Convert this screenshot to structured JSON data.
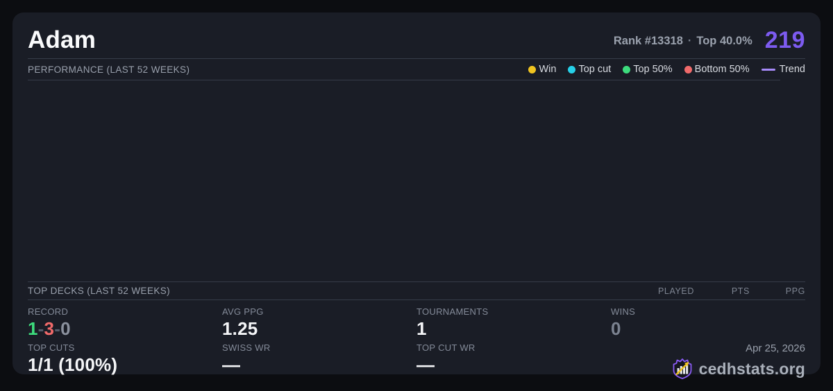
{
  "player": {
    "name": "Adam",
    "rank_label": "Rank #13318",
    "separator": "·",
    "top_percent": "Top 40.0%",
    "score": "219"
  },
  "performance": {
    "title": "PERFORMANCE (LAST 52 WEEKS)",
    "legend": [
      {
        "label": "Win",
        "color": "#f0c420"
      },
      {
        "label": "Top cut",
        "color": "#26d0e8"
      },
      {
        "label": "Top 50%",
        "color": "#3ddc7d"
      },
      {
        "label": "Bottom 50%",
        "color": "#f06a6a"
      },
      {
        "label": "Trend",
        "color": "#a78bfa"
      }
    ]
  },
  "top_decks": {
    "title": "TOP DECKS (LAST 52 WEEKS)",
    "columns": [
      "PLAYED",
      "PTS",
      "PPG"
    ]
  },
  "stats": {
    "record": {
      "label": "RECORD",
      "wins": "1",
      "losses": "3",
      "draws": "0",
      "sep": "-"
    },
    "avg_ppg": {
      "label": "AVG PPG",
      "value": "1.25"
    },
    "tournaments": {
      "label": "TOURNAMENTS",
      "value": "1"
    },
    "wins": {
      "label": "WINS",
      "value": "0"
    },
    "top_cuts": {
      "label": "TOP CUTS",
      "value": "1/1 (100%)"
    },
    "swiss_wr": {
      "label": "SWISS WR",
      "value": "—"
    },
    "top_cut_wr": {
      "label": "TOP CUT WR",
      "value": "—"
    }
  },
  "footer": {
    "date": "Apr 25, 2026",
    "brand": "cedhstats.org"
  },
  "colors": {
    "accent_purple": "#7d5bf0",
    "record_win": "#3ddc7d",
    "record_loss": "#f06a6a",
    "record_draw": "#8b919e",
    "record_sep": "#565d6b",
    "muted_value": "#7b8290"
  }
}
